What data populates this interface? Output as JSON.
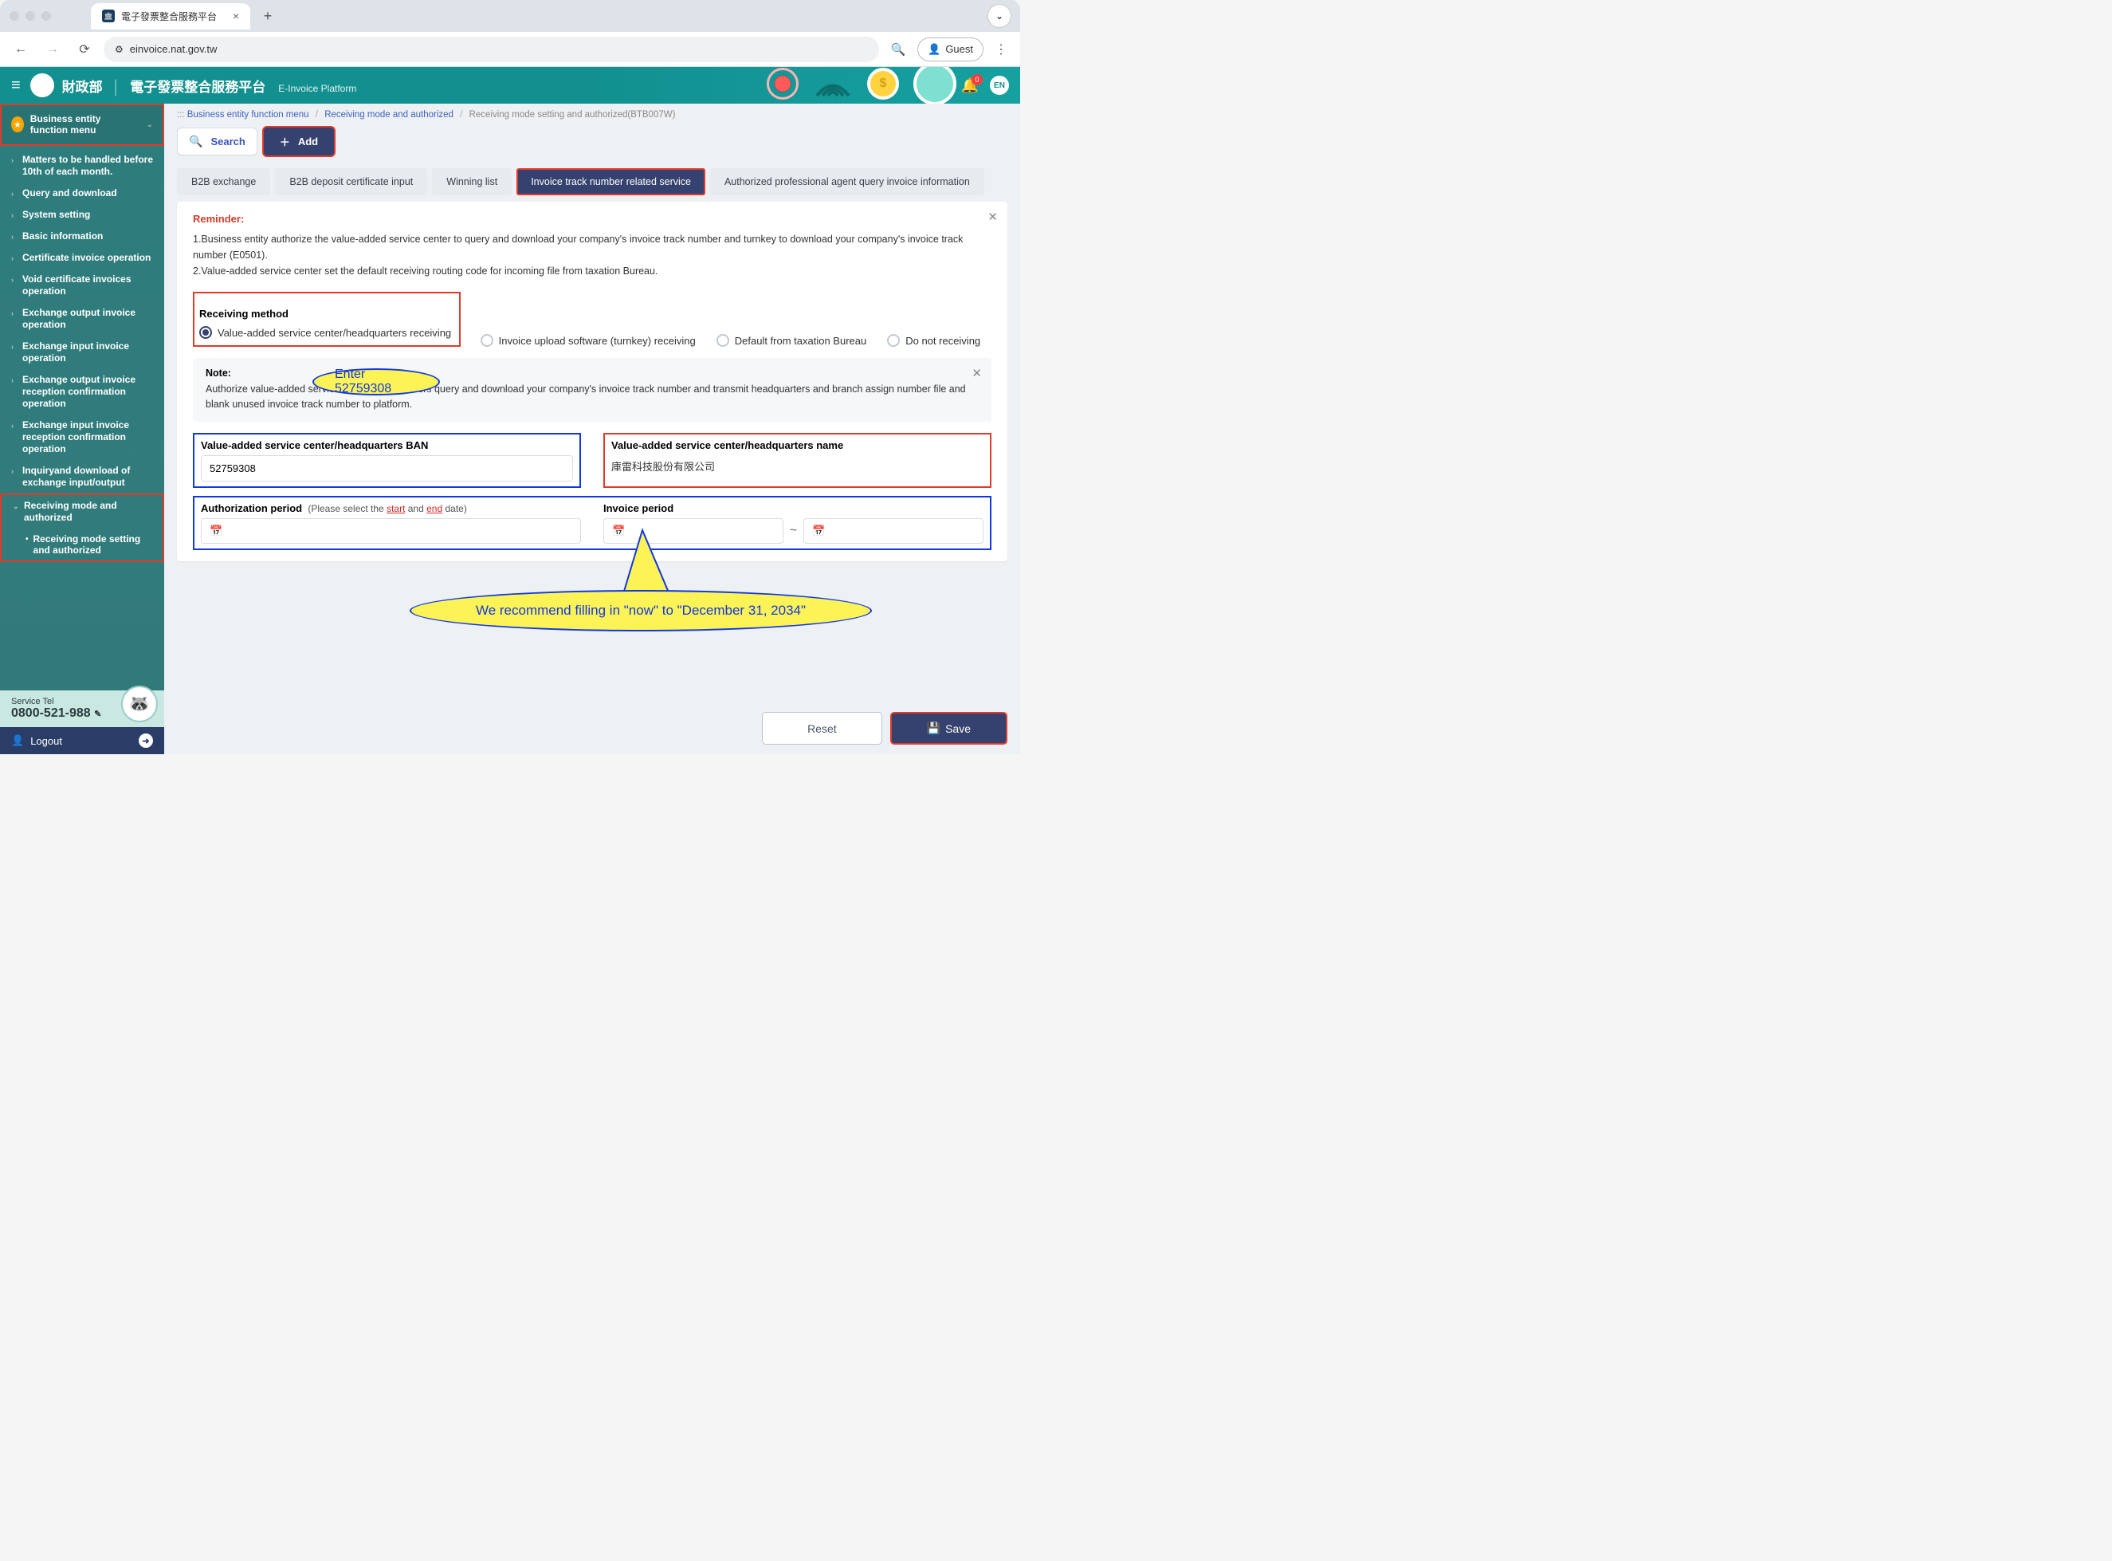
{
  "browser": {
    "tab_title": "電子發票整合服務平台",
    "url": "einvoice.nat.gov.tw",
    "guest": "Guest"
  },
  "header": {
    "org": "財政部",
    "system": "電子發票整合服務平台",
    "en": "E-Invoice Platform",
    "lang": "EN",
    "badge": "0"
  },
  "sidebar": {
    "head": "Business entity function menu",
    "items": [
      "Matters to be handled before 10th of each month.",
      "Query and download",
      "System setting",
      "Basic information",
      "Certificate invoice operation",
      "Void certificate invoices operation",
      "Exchange output invoice operation",
      "Exchange input invoice operation",
      "Exchange output invoice reception confirmation operation",
      "Exchange input invoice reception confirmation operation",
      "Inquiryand download of exchange input/output"
    ],
    "recv_mode": "Receiving mode and authorized",
    "recv_sub": "Receiving mode setting and authorized",
    "service_tel_label": "Service Tel",
    "service_tel": "0800-521-988",
    "logout": "Logout"
  },
  "crumbs": {
    "prefix": ":::",
    "c1": "Business entity function menu",
    "c2": "Receiving mode and authorized",
    "c3": "Receiving mode setting and authorized(BTB007W)"
  },
  "toolbar": {
    "search": "Search",
    "add": "Add"
  },
  "tabs": [
    "B2B exchange",
    "B2B deposit certificate input",
    "Winning list",
    "Invoice track number related service",
    "Authorized professional agent query invoice information"
  ],
  "reminder": {
    "title": "Reminder:",
    "l1": "1.Business entity authorize the value-added service center to query and download your company's invoice track number and turnkey to download your company's invoice track number (E0501).",
    "l2": "2.Value-added service center set the default receiving routing code for incoming file from taxation Bureau."
  },
  "method": {
    "title": "Receiving method",
    "opt1": "Value-added service center/headquarters receiving",
    "opt2": "Invoice upload software (turnkey) receiving",
    "opt3": "Default from taxation Bureau",
    "opt4": "Do not receiving"
  },
  "note": {
    "title": "Note:",
    "text": "Authorize value-added service center/headquarters query and download your company's invoice track number and transmit headquarters and branch assign number file and blank unused invoice track number to platform."
  },
  "form": {
    "ban_label": "Value-added service center/headquarters BAN",
    "ban_value": "52759308",
    "name_label": "Value-added service center/headquarters name",
    "name_value": "庫雷科技股份有限公司",
    "authp_label": "Authorization period",
    "authp_hint_pre": "(Please select the ",
    "authp_start": "start",
    "authp_and": " and ",
    "authp_end": "end",
    "authp_hint_post": " date)",
    "invp_label": "Invoice period"
  },
  "callouts": {
    "enter": "Enter 52759308",
    "recommend": "We recommend filling in \"now\" to \"December 31, 2034\""
  },
  "buttons": {
    "reset": "Reset",
    "save": "Save"
  }
}
